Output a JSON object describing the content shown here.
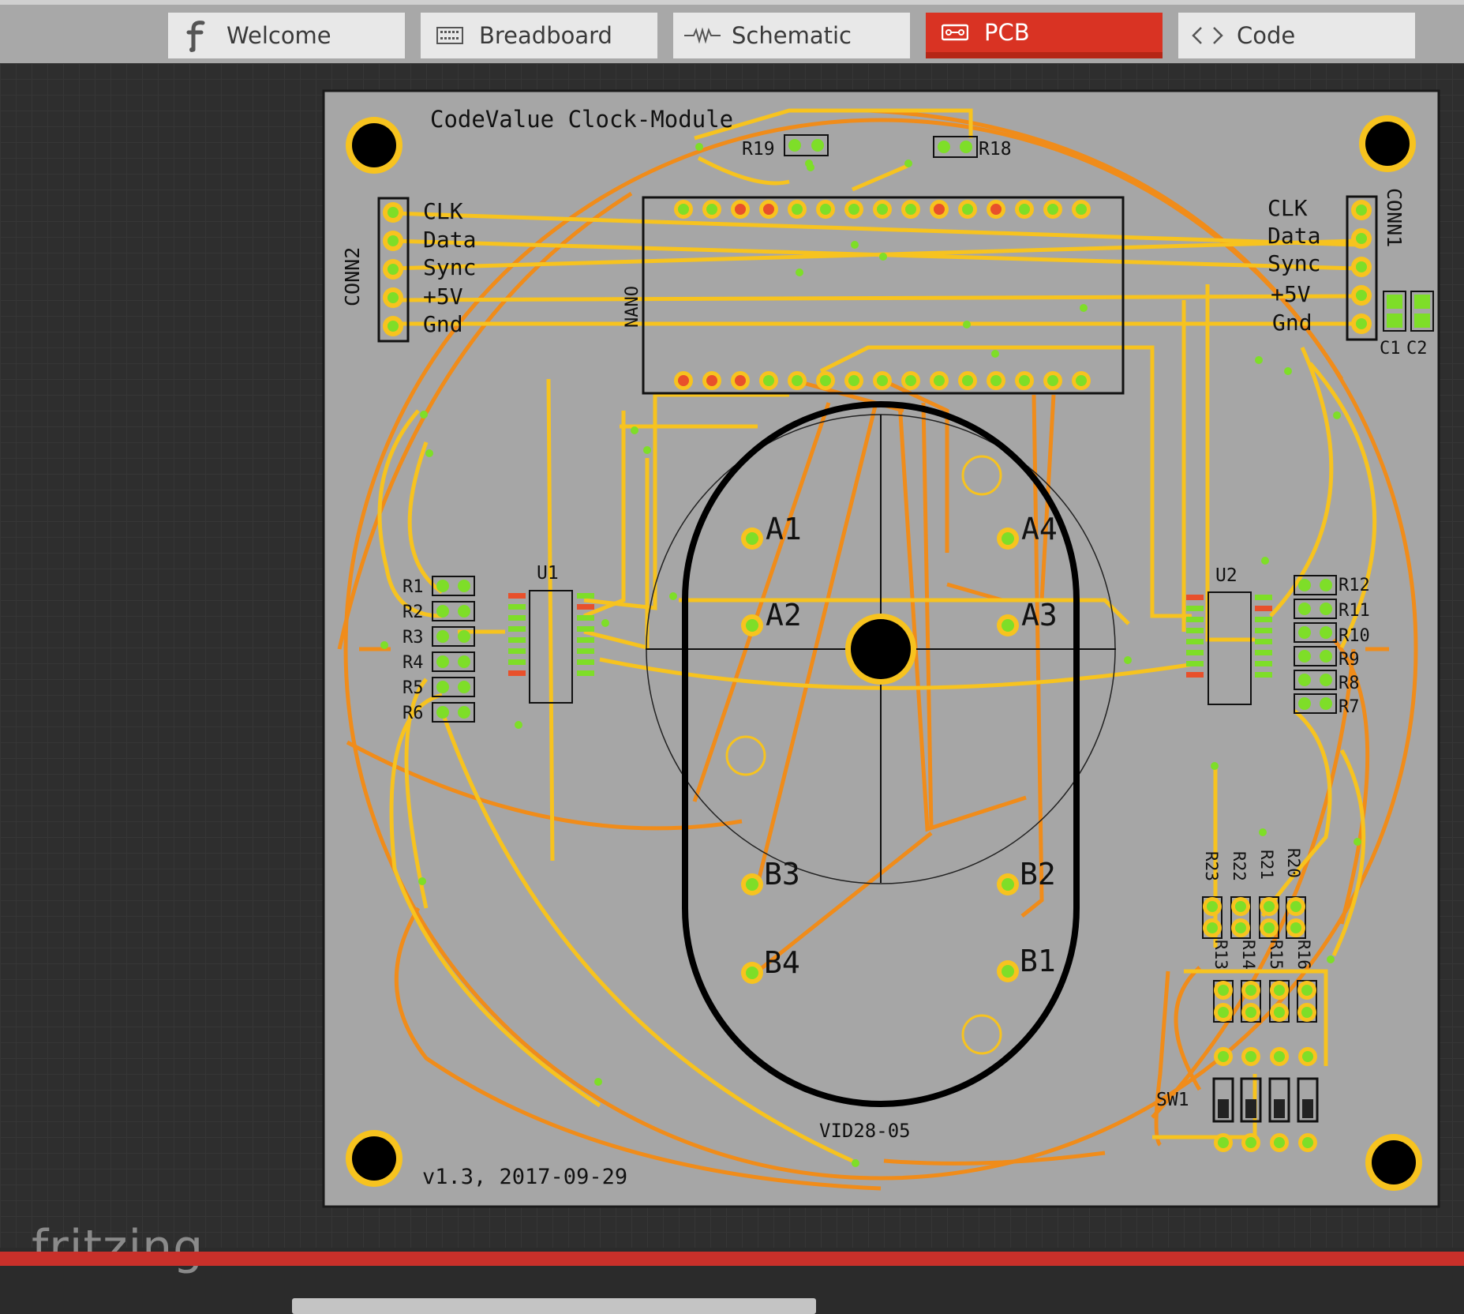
{
  "tabs": [
    {
      "label": "Welcome",
      "icon": "fritzing-f-icon"
    },
    {
      "label": "Breadboard",
      "icon": "breadboard-icon"
    },
    {
      "label": "Schematic",
      "icon": "schematic-icon"
    },
    {
      "label": "PCB",
      "icon": "pcb-icon",
      "active": true
    },
    {
      "label": "Code",
      "icon": "code-icon"
    }
  ],
  "logo": "fritzing",
  "colors": {
    "accent": "#d93323",
    "board": "#a6a6a6",
    "trace_top": "#f7c31f",
    "trace_bottom": "#f08c1a",
    "pad_green": "#7ede28",
    "pad_red": "#e8502b"
  },
  "pcb": {
    "title": "CodeValue Clock-Module",
    "version": "v1.3, 2017-09-29",
    "conn_left": {
      "name": "CONN2",
      "pins": [
        "CLK",
        "Data",
        "Sync",
        "+5V",
        "Gnd"
      ]
    },
    "conn_right": {
      "name": "CONN1",
      "pins": [
        "CLK",
        "Data",
        "Sync",
        "+5V",
        "Gnd"
      ]
    },
    "nano_label": "NANO",
    "caps": [
      "C1",
      "C2"
    ],
    "chips": [
      "U1",
      "U2"
    ],
    "left_resistors": [
      "R1",
      "R2",
      "R3",
      "R4",
      "R5",
      "R6"
    ],
    "right_resistors": [
      "R12",
      "R11",
      "R10",
      "R9",
      "R8",
      "R7"
    ],
    "top_resistors": [
      "R19",
      "R18"
    ],
    "motor": {
      "name": "VID28-05",
      "pins": [
        "A1",
        "A4",
        "A2",
        "A3",
        "B3",
        "B2",
        "B4",
        "B1"
      ]
    },
    "bottom_resistors_top": [
      "R23",
      "R22",
      "R21",
      "R20"
    ],
    "bottom_resistors_bottom": [
      "R13",
      "R14",
      "R15",
      "R16"
    ],
    "switch": "SW1"
  }
}
